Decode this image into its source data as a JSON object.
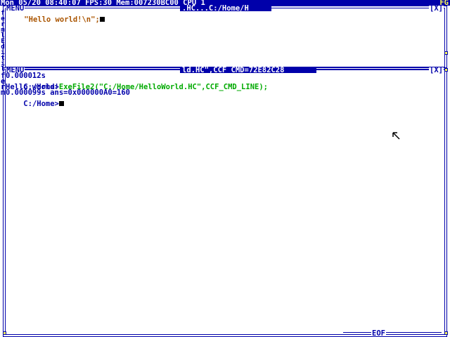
{
  "status_bar": {
    "text": "Mon 05/20 08:40:07 FPS:30 Mem:007230BC00 CPU 1",
    "right": "FG"
  },
  "editor_window": {
    "menu_label": "MENU",
    "title": ".HC...C:/Home/H",
    "close_label": "[X]",
    "line1_text": "\"Hello world!\\n\";"
  },
  "left_letters": [
    "f",
    "e",
    "r",
    "m",
    "l",
    "E",
    "d",
    "i",
    "t",
    "i",
    "l",
    "g"
  ],
  "terminal_window": {
    "menu_label": "MENU",
    "title": "ld.HC\",CCF_CMD=72E82C28",
    "close_label": "[X]",
    "lines": {
      "time1": "0.000012s",
      "prompt1": "C:/Home>",
      "command": "ExeFile2(\"C:/Home/HelloWorld.HC\",CCF_CMD_LINE);",
      "output": "Hello world!",
      "result": "0.000099s ans=0x000000A0=160",
      "prompt2": "C:/Home>"
    },
    "left_prefixes": [
      "f",
      "e",
      "r",
      "m"
    ]
  },
  "bottom": {
    "eof_label": "EOF"
  },
  "colors": {
    "frame": "#0000aa",
    "string_text": "#aa5500",
    "command_text": "#00aa00",
    "background": "#ffffff"
  }
}
